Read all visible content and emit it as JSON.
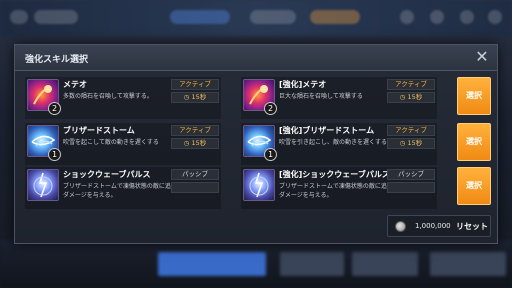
{
  "dialog": {
    "title": "強化スキル選択",
    "close_symbol": "✕"
  },
  "skills": [
    {
      "base": {
        "name": "メテオ",
        "description": "多数の隕石を召喚して攻撃する。",
        "type": "アクティブ",
        "cooldown": "15秒",
        "level": "2",
        "icon": "meteor-icon"
      },
      "enhanced": {
        "name": "[強化]メテオ",
        "description": "巨大な隕石を召喚して攻撃する",
        "type": "アクティブ",
        "cooldown": "15秒",
        "level": "2",
        "icon": "meteor-icon"
      },
      "select_label": "選択"
    },
    {
      "base": {
        "name": "ブリザードストーム",
        "description": "吹雪を起こして敵の動きを遅くする",
        "type": "アクティブ",
        "cooldown": "15秒",
        "level": "1",
        "icon": "blizzard-icon"
      },
      "enhanced": {
        "name": "[強化]ブリザードストーム",
        "description": "吹雪を引き起こし、敵の動きを遅くする",
        "type": "アクティブ",
        "cooldown": "15秒",
        "level": "1",
        "icon": "blizzard-icon"
      },
      "select_label": "選択"
    },
    {
      "base": {
        "name": "ショックウェーブパルス",
        "description": "ブリザードストームで凍傷状態の敵に追加ダメージを与える。",
        "type": "パッシブ",
        "icon": "shockwave-icon"
      },
      "enhanced": {
        "name": "[強化]ショックウェーブパルス",
        "description": "ブリザードストームで凍傷状態の敵に追加ダメージを与える。",
        "type": "パッシブ",
        "icon": "shockwave-icon"
      },
      "select_label": "選択"
    }
  ],
  "reset": {
    "cost": "1,000,000",
    "label": "リセット",
    "currency_icon": "silver-coin-icon"
  },
  "colors": {
    "select_button": "#f5961e",
    "active_badge": "#ffb23a",
    "cooldown_text": "#f0c060"
  }
}
